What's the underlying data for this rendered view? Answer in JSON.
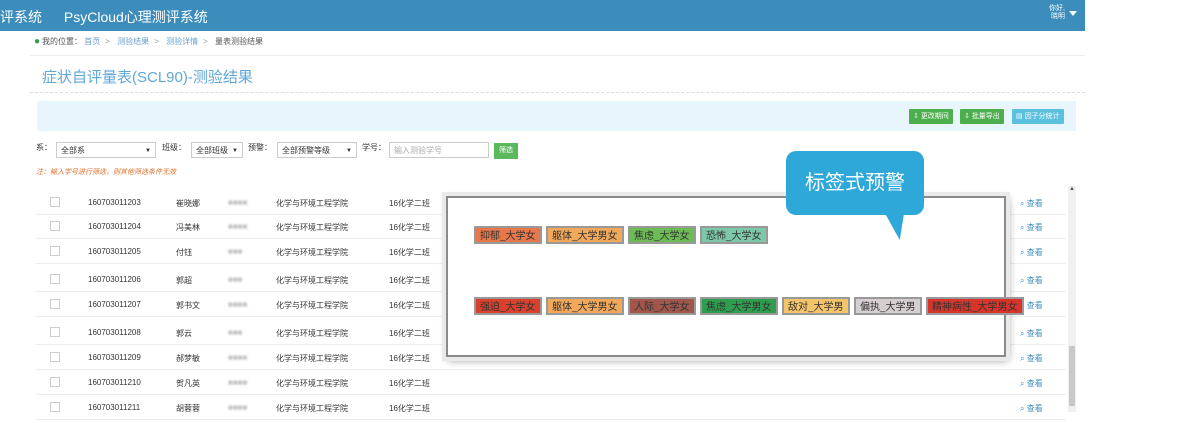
{
  "header": {
    "title_left": "评系统",
    "title_main": "PsyCloud心理测评系统",
    "user_line1": "你好,",
    "user_line2": "晓明"
  },
  "breadcrumb": {
    "label": "我的位置：",
    "items": [
      "首页",
      "测验结果",
      "测验详情",
      "量表测验结果"
    ]
  },
  "page_title": "症状自评量表(SCL90)-测验结果",
  "toolbar": {
    "btn_export_one": "更改期间",
    "btn_batch_export": "批量导出",
    "btn_factor_stats": "因子分统计"
  },
  "filters": {
    "dept_label": "系：",
    "dept_value": "全部系",
    "class_label": "班级：",
    "class_value": "全部班级",
    "warn_label": "预警：",
    "warn_value": "全部预警等级",
    "id_label": "学号：",
    "id_placeholder": "输入测验学号",
    "filter_btn": "筛选",
    "hint": "注：输入学号进行筛选，则其他筛选条件无效"
  },
  "table": {
    "view_label": "查看",
    "rows": [
      {
        "id": "160703011203",
        "name": "崔晓娜",
        "masked": "■■■■",
        "college": "化学与环境工程学院",
        "class": "16化学二班"
      },
      {
        "id": "160703011204",
        "name": "冯美林",
        "masked": "■■■■",
        "college": "化学与环境工程学院",
        "class": "16化学二班"
      },
      {
        "id": "160703011205",
        "name": "付钰",
        "masked": "■■■",
        "college": "化学与环境工程学院",
        "class": "16化学二班"
      },
      {
        "id": "160703011206",
        "name": "郭超",
        "masked": "■■■",
        "college": "化学与环境工程学院",
        "class": "16化学二班"
      },
      {
        "id": "160703011207",
        "name": "郭书文",
        "masked": "■■■■",
        "college": "化学与环境工程学院",
        "class": "16化学二班"
      },
      {
        "id": "160703011208",
        "name": "郭云",
        "masked": "■■■",
        "college": "化学与环境工程学院",
        "class": "16化学二班"
      },
      {
        "id": "160703011209",
        "name": "郝梦敏",
        "masked": "■■■■",
        "college": "化学与环境工程学院",
        "class": "16化学二班"
      },
      {
        "id": "160703011210",
        "name": "贺凡英",
        "masked": "■■■■",
        "college": "化学与环境工程学院",
        "class": "16化学二班"
      },
      {
        "id": "160703011211",
        "name": "胡蓉蓉",
        "masked": "■■■■",
        "college": "化学与环境工程学院",
        "class": "16化学二班"
      }
    ]
  },
  "popup": {
    "row1_tags": [
      {
        "label": "抑郁_大学女",
        "color": "#e8784a"
      },
      {
        "label": "躯体_大学男女",
        "color": "#f1a85a"
      },
      {
        "label": "焦虑_大学女",
        "color": "#6dbb55"
      },
      {
        "label": "恐怖_大学女",
        "color": "#7dc8a8"
      }
    ],
    "row2_tags": [
      {
        "label": "强迫_大学女",
        "color": "#d9412c"
      },
      {
        "label": "躯体_大学男女",
        "color": "#f1a85a"
      },
      {
        "label": "人际_大学女",
        "color": "#a0564a"
      },
      {
        "label": "焦虑_大学男女",
        "color": "#2d9d4f"
      },
      {
        "label": "敌对_大学男",
        "color": "#f3c46a"
      },
      {
        "label": "偏执_大学男",
        "color": "#d6cfd0"
      },
      {
        "label": "精神病性_大学男女",
        "color": "#d8352a"
      }
    ]
  },
  "callout": "标签式预警"
}
